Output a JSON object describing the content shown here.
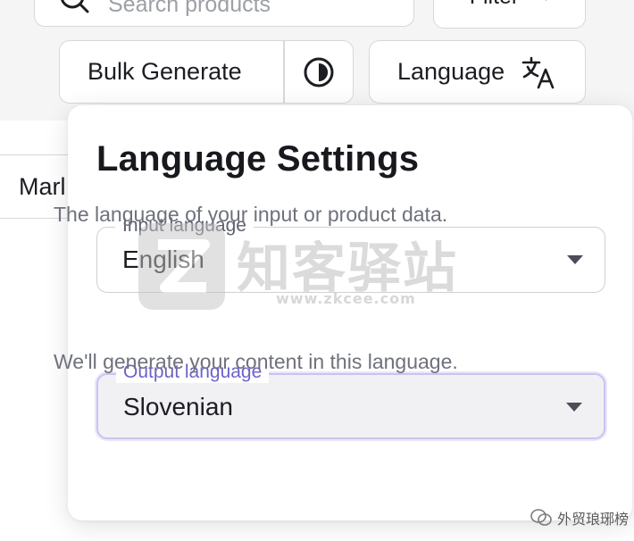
{
  "toolbar": {
    "search_placeholder": "Search products",
    "filter_label": "Filter",
    "filter_caret": "▾",
    "bulk_generate_label": "Bulk Generate",
    "language_label": "Language"
  },
  "tabs": {
    "market_label": "Marl"
  },
  "language_settings": {
    "title": "Language Settings",
    "input": {
      "legend": "Input language",
      "value": "English",
      "helper": "The language of your input or product data."
    },
    "output": {
      "legend": "Output language",
      "value": "Slovenian",
      "helper": "We'll generate your content in this language."
    }
  },
  "watermark": {
    "text_cn": "知客驿站",
    "url": "www.zkcee.com"
  },
  "credit": {
    "text": "外贸琅琊榜"
  },
  "colors": {
    "accent": "#6b62c9",
    "focus_ring": "#c9c4f2",
    "border": "#d7d8dd"
  },
  "icons": {
    "search": "search-icon",
    "theme": "half-moon-icon",
    "translate": "translate-icon",
    "dropdown": "chevron-down-icon"
  }
}
